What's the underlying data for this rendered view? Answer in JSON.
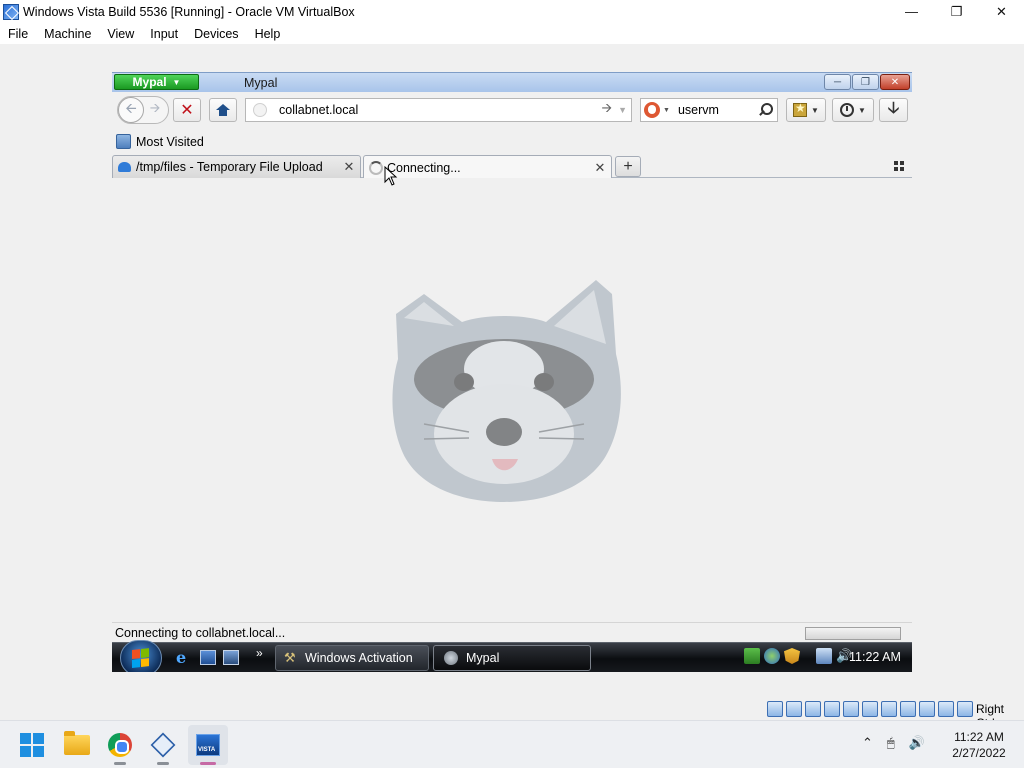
{
  "vbox": {
    "window_title": "Windows Vista Build 5536 [Running] - Oracle VM VirtualBox",
    "menu": [
      "File",
      "Machine",
      "View",
      "Input",
      "Devices",
      "Help"
    ],
    "host_key_label": "Right Ctrl"
  },
  "mypal": {
    "app_button_label": "Mypal",
    "window_title": "Mypal",
    "url": "collabnet.local",
    "search_text": "uservm",
    "bookmarks": [
      "Most Visited"
    ],
    "tabs": [
      {
        "label": "/tmp/files - Temporary File Upload",
        "active": false
      },
      {
        "label": "Connecting...",
        "active": true
      }
    ],
    "status_text": "Connecting to collabnet.local..."
  },
  "vista_taskbar": {
    "tasks": [
      {
        "label": "Windows Activation",
        "active": false
      },
      {
        "label": "Mypal",
        "active": true
      }
    ],
    "clock": "11:22 AM"
  },
  "host_taskbar": {
    "time": "11:22 AM",
    "date": "2/27/2022"
  },
  "colors": {
    "mypal_green": "#1a9a22",
    "close_red": "#c2402a",
    "vista_taskbar": "#0b0d10"
  }
}
